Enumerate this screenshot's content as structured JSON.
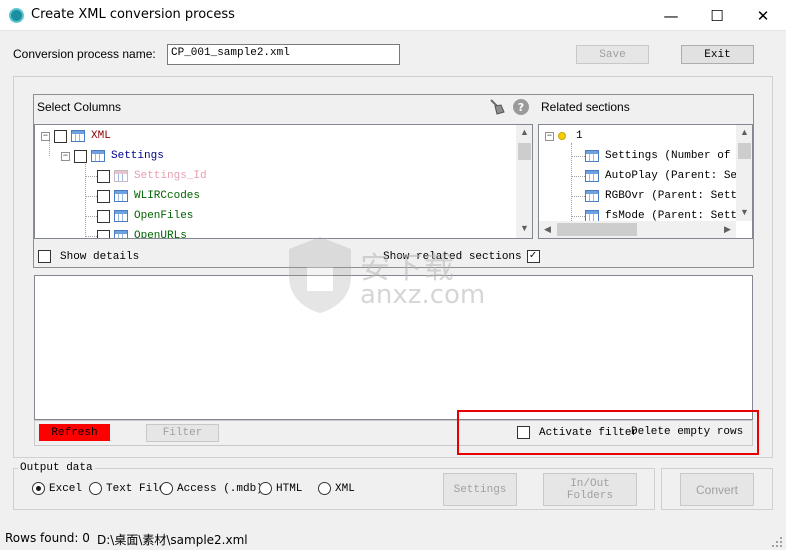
{
  "window": {
    "title": "Create XML conversion process",
    "minimize": "—",
    "maximize": "☐",
    "close": "✕"
  },
  "header": {
    "process_name_label": "Conversion process name:",
    "process_name_value": "CP_001_sample2.xml",
    "save_label": "Save",
    "exit_label": "Exit"
  },
  "select_columns": {
    "title": "Select Columns",
    "tree": [
      {
        "label": "XML",
        "color": "#8b0000"
      },
      {
        "label": "Settings",
        "color": "#00008b"
      },
      {
        "label": "Settings_Id",
        "color": "#e8a0b0"
      },
      {
        "label": "WLIRCcodes",
        "color": "#006400"
      },
      {
        "label": "OpenFiles",
        "color": "#006400"
      },
      {
        "label": "OpenURLs",
        "color": "#006400"
      }
    ]
  },
  "related_sections": {
    "title": "Related sections",
    "root_label": "1",
    "items": [
      "Settings (Number of rows",
      "AutoPlay (Parent: Setti",
      "RGBOvr (Parent: Settin",
      "fsMode (Parent: Settin"
    ]
  },
  "options": {
    "show_details": "Show details",
    "show_related_sections": "Show related sections"
  },
  "filter_bar": {
    "refresh_label": "Refresh",
    "filter_label": "Filter",
    "activate_filter": "Activate filter",
    "delete_empty_rows": "Delete empty rows",
    "highlight_color": "#e60000"
  },
  "output_data": {
    "title": "Output data",
    "options": [
      "Excel",
      "Text File",
      "Access (.mdb)",
      "HTML",
      "XML"
    ],
    "selected": "Excel",
    "settings_label": "Settings",
    "inout_label_1": "In/Out",
    "inout_label_2": "Folders",
    "convert_label": "Convert"
  },
  "status": {
    "rows_found": "Rows found: 0",
    "path": "D:\\桌面\\素材\\sample2.xml"
  },
  "watermark": {
    "line1": "安下载",
    "line2": "anxz.com"
  }
}
